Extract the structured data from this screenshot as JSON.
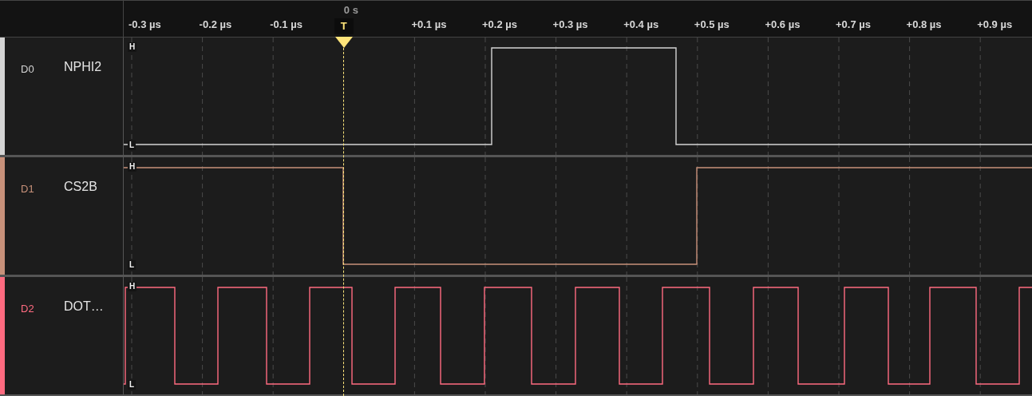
{
  "time_axis": {
    "ticks": [
      {
        "kind": "tick",
        "label": "-0.3 µs"
      },
      {
        "kind": "tick",
        "label": "-0.2 µs"
      },
      {
        "kind": "tick",
        "label": "-0.1 µs"
      },
      {
        "kind": "trigger",
        "label": "T",
        "caption": "0 s"
      },
      {
        "kind": "tick",
        "label": "+0.1 µs"
      },
      {
        "kind": "tick",
        "label": "+0.2 µs"
      },
      {
        "kind": "tick",
        "label": "+0.3 µs"
      },
      {
        "kind": "tick",
        "label": "+0.4 µs"
      },
      {
        "kind": "tick",
        "label": "+0.5 µs"
      },
      {
        "kind": "tick",
        "label": "+0.6 µs"
      },
      {
        "kind": "tick",
        "label": "+0.7 µs"
      },
      {
        "kind": "tick",
        "label": "+0.8 µs"
      },
      {
        "kind": "tick",
        "label": "+0.9 µs"
      }
    ]
  },
  "channels": [
    {
      "id": "D0",
      "name": "NPHI2",
      "color": "#d4d4d4",
      "high_label": "H",
      "low_label": "L"
    },
    {
      "id": "D1",
      "name": "CS2B",
      "color": "#c8917a",
      "high_label": "H",
      "low_label": "L"
    },
    {
      "id": "D2",
      "name": "DOT…",
      "color": "#ff6b80",
      "high_label": "H",
      "low_label": "L"
    }
  ]
}
